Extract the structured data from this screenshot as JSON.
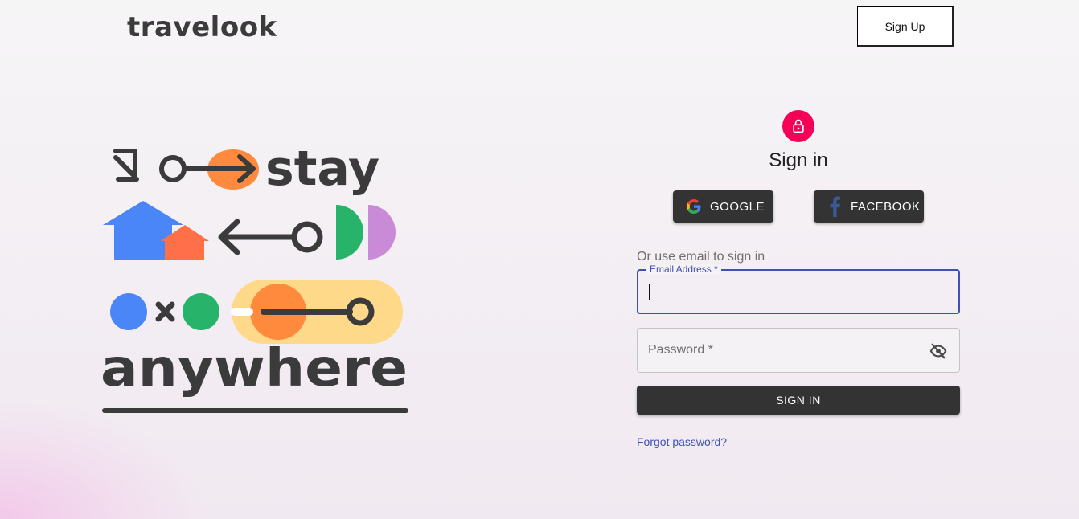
{
  "header": {
    "logo_text": "travelook",
    "signup_label": "Sign Up"
  },
  "illustration": {
    "word_top": "stay",
    "word_bottom": "anywhere"
  },
  "form": {
    "title": "Sign in",
    "social": {
      "google_label": "GOOGLE",
      "facebook_label": "FACEBOOK"
    },
    "divider_text": "Or use email to sign in",
    "email": {
      "label": "Email Address *",
      "value": ""
    },
    "password": {
      "label": "Password *",
      "value": ""
    },
    "submit_label": "SIGN IN",
    "forgot_label": "Forgot password?"
  },
  "colors": {
    "accent": "#f50057",
    "primary": "#3f51b5",
    "button_dark": "#333333",
    "art_orange": "#ff8a3d",
    "art_blue": "#4a86f7",
    "art_green": "#27b36a",
    "art_purple": "#c98ad8",
    "art_yellow": "#ffd98a",
    "art_coral": "#ff7048"
  },
  "icons": {
    "lock": "lock-icon",
    "google": "google-icon",
    "facebook": "facebook-icon",
    "eye": "eye-off-icon"
  }
}
